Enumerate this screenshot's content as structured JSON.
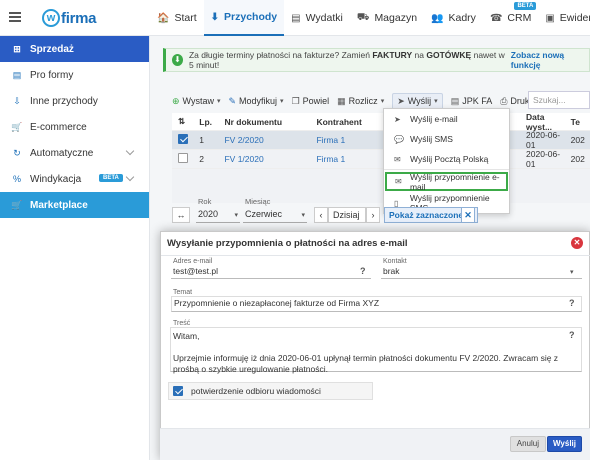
{
  "brand": {
    "logo_letter": "w",
    "logo_text": "firma"
  },
  "nav": [
    {
      "icon": "home-icon",
      "glyph": "🏠",
      "label": "Start"
    },
    {
      "icon": "income-icon",
      "glyph": "⬇",
      "label": "Przychody"
    },
    {
      "icon": "expense-icon",
      "glyph": "▤",
      "label": "Wydatki"
    },
    {
      "icon": "warehouse-icon",
      "glyph": "⛟",
      "label": "Magazyn"
    },
    {
      "icon": "staff-icon",
      "glyph": "👥",
      "label": "Kadry"
    },
    {
      "icon": "crm-icon",
      "glyph": "☎",
      "label": "CRM",
      "badge": "BETA"
    },
    {
      "icon": "records-icon",
      "glyph": "▣",
      "label": "Ewidencje"
    }
  ],
  "sidebar": [
    {
      "icon": "plus-square-icon",
      "glyph": "⊞",
      "label": "Sprzedaż"
    },
    {
      "icon": "document-icon",
      "glyph": "▤",
      "label": "Pro formy"
    },
    {
      "icon": "income-icon",
      "glyph": "⇩",
      "label": "Inne przychody"
    },
    {
      "icon": "cart-icon",
      "glyph": "🛒",
      "label": "E-commerce"
    },
    {
      "icon": "sync-icon",
      "glyph": "↻",
      "label": "Automatyczne"
    },
    {
      "icon": "percent-icon",
      "glyph": "%",
      "label": "Windykacja",
      "badge": "BETA"
    },
    {
      "icon": "cart-icon",
      "glyph": "🛒",
      "label": "Marketplace"
    }
  ],
  "info": {
    "text_before": "Za długie terminy płatności na fakturze? Zamień",
    "bold1": "FAKTURY",
    "text_mid": "na",
    "bold2": "GOTÓWKĘ",
    "text_after": "nawet w 5 minut!",
    "link": "Zobacz nową funkcję"
  },
  "toolbar": {
    "wystaw": "Wystaw",
    "modyfikuj": "Modyfikuj",
    "powiel": "Powiel",
    "rozlicz": "Rozlicz",
    "wyslij": "Wyślij",
    "jpk": "JPK FA",
    "drukuj": "Drukuj",
    "search_placeholder": "Szukaj..."
  },
  "table": {
    "headers": [
      "Lp.",
      "Nr dokumentu",
      "Kontrahent",
      "Data wyst...",
      "Te"
    ],
    "rows": [
      {
        "lp": "1",
        "nr": "FV 2/2020",
        "kontrahent": "Firma 1",
        "data": "2020-06-01",
        "termin": "202",
        "selected": true
      },
      {
        "lp": "2",
        "nr": "FV 1/2020",
        "kontrahent": "Firma 1",
        "data": "2020-06-01",
        "termin": "202",
        "selected": false
      }
    ]
  },
  "dropdown": [
    {
      "icon": "send-icon",
      "glyph": "➤",
      "label": "Wyślij e-mail"
    },
    {
      "icon": "sms-icon",
      "glyph": "💬",
      "label": "Wyślij SMS"
    },
    {
      "icon": "post-icon",
      "glyph": "✉",
      "label": "Wyślij Pocztą Polską"
    },
    {
      "icon": "envelope-icon",
      "glyph": "✉",
      "label": "Wyślij przypomnienie e-mail",
      "highlight": true
    },
    {
      "icon": "phone-icon",
      "glyph": "▯",
      "label": "Wyślij przypomnienie SMS"
    }
  ],
  "filters": {
    "rok_label": "Rok",
    "rok_value": "2020",
    "miesiac_label": "Miesiąc",
    "miesiac_value": "Czerwiec",
    "today": "Dzisiaj",
    "show_selected": "Pokaż zaznaczone: 1"
  },
  "modal": {
    "title": "Wysyłanie przypomnienia o płatności na adres e-mail",
    "email_label": "Adres e-mail",
    "email_value": "test@test.pl",
    "contact_label": "Kontakt",
    "contact_value": "brak",
    "subject_label": "Temat",
    "subject_value": "Przypomnienie o niezapłaconej fakturze od Firma XYZ",
    "body_label": "Treść",
    "body_greeting": "Witam,",
    "body_text": "Uprzejmie informuję iż dnia 2020-06-01 upłynął termin płatności dokumentu FV 2/2020. Zwracam się z prośbą o szybkie uregulowanie płatności.",
    "confirm_label": "potwierdzenie odbioru wiadomości",
    "confirm_checked": true,
    "cancel": "Anuluj",
    "send": "Wyślij"
  },
  "colors": {
    "primary": "#2a5cc4",
    "accent": "#2a9bd8",
    "success": "#3caa48",
    "danger": "#d9363e"
  }
}
